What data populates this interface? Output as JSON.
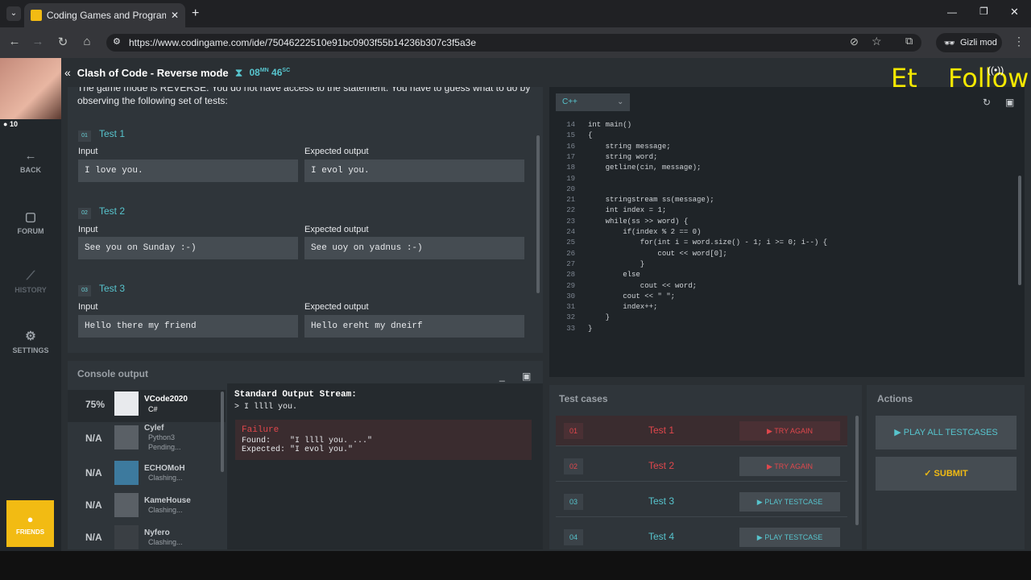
{
  "browser": {
    "tab_title": "Coding Games and Programmi",
    "url": "https://www.codingame.com/ide/75046222510e91bc0903f55b14236b307c3f5a3e",
    "incognito_label": "Gizli mod"
  },
  "overlay": {
    "watermark": "Et Follow",
    "cam_badge": "10"
  },
  "header": {
    "title": "Clash of Code - Reverse mode",
    "timer_min": "08",
    "timer_min_unit": "MN",
    "timer_sec": "46",
    "timer_sec_unit": "SC"
  },
  "leftnav": {
    "back": "BACK",
    "forum": "FORUM",
    "history": "HISTORY",
    "settings": "SETTINGS",
    "friends": "FRIENDS"
  },
  "statement": {
    "intro1": "The game mode is REVERSE: You do not have access to the statement. You have to guess what to do by",
    "intro2": "observing the following set of tests:",
    "input_label": "Input",
    "output_label": "Expected output",
    "tests": [
      {
        "num": "01",
        "title": "Test 1",
        "input": "I love you.",
        "output": "I evol you."
      },
      {
        "num": "02",
        "title": "Test 2",
        "input": "See you on Sunday :-)",
        "output": "See uoy on yadnus :-)"
      },
      {
        "num": "03",
        "title": "Test 3",
        "input": "Hello there my friend",
        "output": "Hello ereht my dneirf"
      }
    ]
  },
  "console": {
    "title": "Console output",
    "players": [
      {
        "pct": "75%",
        "name": "VCode2020",
        "status": "C#"
      },
      {
        "pct": "N/A",
        "name": "Cylef",
        "status": "Python3",
        "status2": "Pending..."
      },
      {
        "pct": "N/A",
        "name": "ECHOMoH",
        "status": "Clashing..."
      },
      {
        "pct": "N/A",
        "name": "KameHouse",
        "status": "Clashing..."
      },
      {
        "pct": "N/A",
        "name": "Nyfero",
        "status": "Clashing..."
      }
    ],
    "stream_title": "Standard Output Stream:",
    "stream_line": "> I llll you.",
    "failure": "Failure",
    "found": "Found:    \"I llll you. ...\"",
    "expected": "Expected: \"I evol you.\""
  },
  "editor": {
    "language": "C++",
    "lines": [
      {
        "n": "14",
        "t": "int main()"
      },
      {
        "n": "15",
        "t": "{"
      },
      {
        "n": "16",
        "t": "    string message;"
      },
      {
        "n": "17",
        "t": "    string word;"
      },
      {
        "n": "18",
        "t": "    getline(cin, message);"
      },
      {
        "n": "19",
        "t": ""
      },
      {
        "n": "20",
        "t": ""
      },
      {
        "n": "21",
        "t": "    stringstream ss(message);"
      },
      {
        "n": "22",
        "t": "    int index = 1;"
      },
      {
        "n": "23",
        "t": "    while(ss >> word) {"
      },
      {
        "n": "24",
        "t": "        if(index % 2 == 0)"
      },
      {
        "n": "25",
        "t": "            for(int i = word.size() - 1; i >= 0; i--) {"
      },
      {
        "n": "26",
        "t": "                cout << word[0];"
      },
      {
        "n": "27",
        "t": "            }"
      },
      {
        "n": "28",
        "t": "        else"
      },
      {
        "n": "29",
        "t": "            cout << word;"
      },
      {
        "n": "30",
        "t": "        cout << \" \";"
      },
      {
        "n": "31",
        "t": "        index++;"
      },
      {
        "n": "32",
        "t": "    }"
      },
      {
        "n": "33",
        "t": "}"
      }
    ]
  },
  "testcases": {
    "title": "Test cases",
    "items": [
      {
        "id": "01",
        "name": "Test 1",
        "btn": "▶ TRY AGAIN",
        "failed": true
      },
      {
        "id": "02",
        "name": "Test 2",
        "btn": "▶ TRY AGAIN",
        "failed": true
      },
      {
        "id": "03",
        "name": "Test 3",
        "btn": "▶ PLAY TESTCASE",
        "failed": false
      },
      {
        "id": "04",
        "name": "Test 4",
        "btn": "▶ PLAY TESTCASE",
        "failed": false
      }
    ]
  },
  "actions": {
    "title": "Actions",
    "play_all": "▶ PLAY ALL TESTCASES",
    "submit": "✓  SUBMIT"
  },
  "colors": {
    "accent": "#57c4cd",
    "fail": "#e0474c",
    "friends": "#f2bb13"
  }
}
